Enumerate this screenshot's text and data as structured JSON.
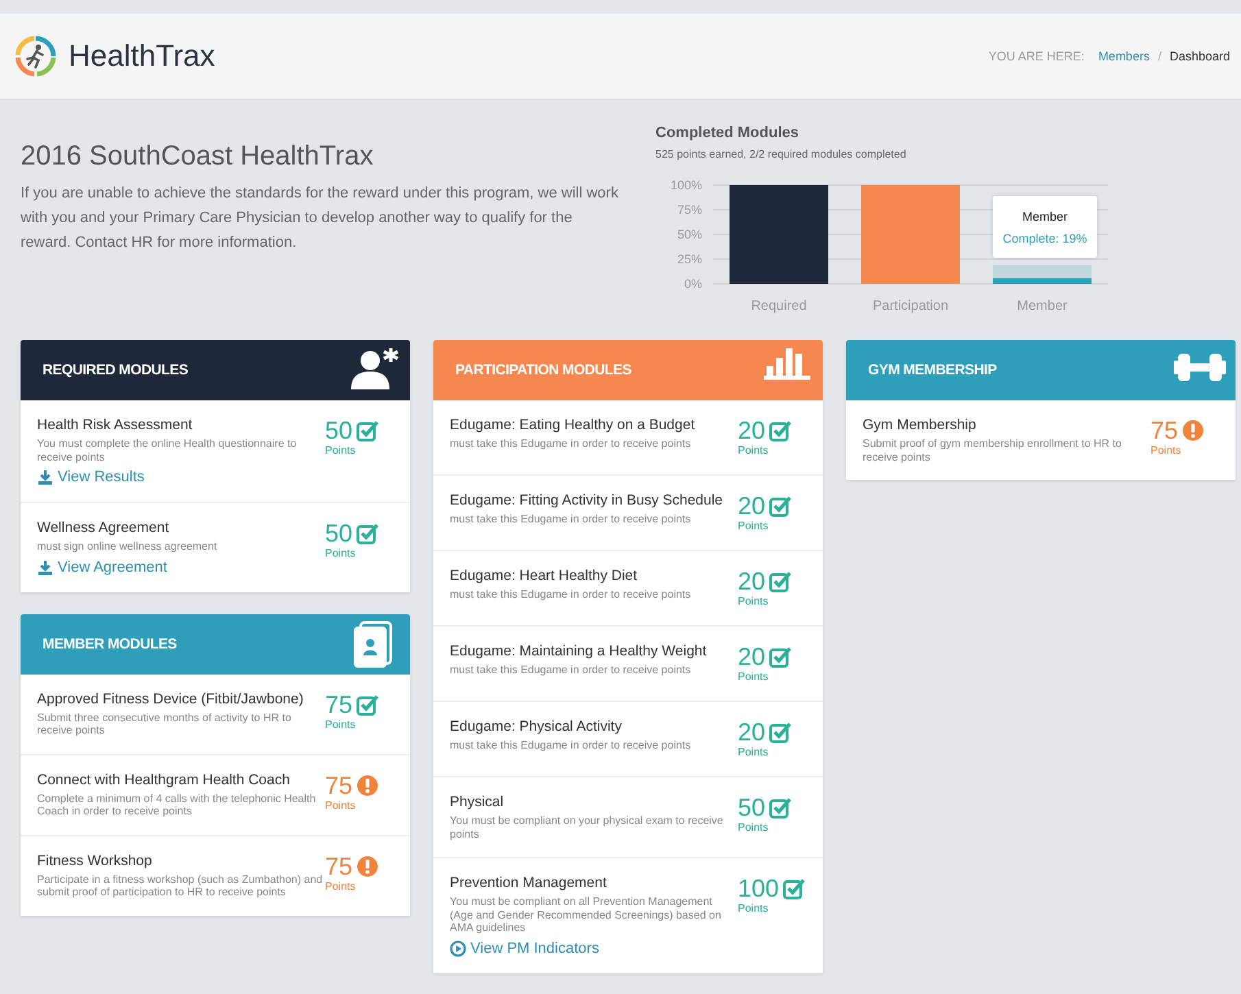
{
  "header": {
    "logo_text": "HealthTrax",
    "breadcrumb": {
      "label": "YOU ARE HERE:",
      "items": [
        {
          "text": "Members",
          "link": true
        },
        {
          "text": "/",
          "kind": "separator"
        },
        {
          "text": "Dashboard",
          "link": false
        }
      ]
    }
  },
  "intro": {
    "title": "2016 SouthCoast HealthTrax",
    "text": "If you are unable to achieve the standards for the reward under this program, we will work with you and your Primary Care Physician to develop another way to qualify for the reward. Contact HR for more information."
  },
  "completed": {
    "title": "Completed Modules",
    "subtitle": "525 points earned, 2/2 required modules completed",
    "chart_data": {
      "type": "bar",
      "grid": true,
      "ylim": [
        0,
        100
      ],
      "yticks": [
        {
          "value": 0,
          "label": "0%"
        },
        {
          "value": 25,
          "label": "25%"
        },
        {
          "value": 50,
          "label": "50%"
        },
        {
          "value": 75,
          "label": "75%"
        },
        {
          "value": 100,
          "label": "100%"
        }
      ],
      "series": [
        {
          "name": "Required",
          "color": "#1e2838",
          "values": [
            100
          ]
        },
        {
          "name": "Participation",
          "color": "#f5874f",
          "values": [
            100
          ]
        },
        {
          "name": "Member",
          "color": "#2e9fba",
          "values": [
            19
          ]
        }
      ]
    },
    "tooltip": {
      "title": "Member",
      "text": "Complete: 19%"
    }
  },
  "columns": [
    [
      {
        "title": "REQUIRED MODULES",
        "color": "#1e2838",
        "kind": "person",
        "items": [
          {
            "title": "Health Risk Assessment",
            "description": "You must complete the online Health questionnaire to receive points",
            "points": "50",
            "unit": "Points",
            "complete": true,
            "link": {
              "text": "View Results",
              "kind": "download"
            }
          },
          {
            "title": "Wellness Agreement",
            "description": "must sign online wellness agreement",
            "points": "50",
            "unit": "Points",
            "complete": true,
            "link": {
              "text": "View Agreement",
              "kind": "download"
            }
          }
        ]
      },
      {
        "title": "MEMBER MODULES",
        "color": "#2e9fba",
        "kind": "card",
        "items": [
          {
            "title": "Approved Fitness Device (Fitbit/Jawbone)",
            "description": "Submit three consecutive months of activity to HR to receive points",
            "points": "75",
            "unit": "Points",
            "complete": true
          },
          {
            "title": "Connect with Healthgram Health Coach",
            "description": "Complete a minimum of 4 calls with the telephonic Health Coach in order to receive points",
            "points": "75",
            "unit": "Points",
            "complete": false
          },
          {
            "title": "Fitness Workshop",
            "description": "Participate in a fitness workshop (such as Zumbathon) and submit proof of participation to HR to receive points",
            "points": "75",
            "unit": "Points",
            "complete": false
          }
        ]
      }
    ],
    [
      {
        "title": "PARTICIPATION MODULES",
        "color": "#f5874f",
        "kind": "bars",
        "items": [
          {
            "title": "Edugame: Eating Healthy on a Budget",
            "description": "must take this Edugame in order to receive points",
            "points": "20",
            "unit": "Points",
            "complete": true
          },
          {
            "title": "Edugame: Fitting Activity in Busy Schedule",
            "description": "must take this Edugame in order to receive points",
            "points": "20",
            "unit": "Points",
            "complete": true
          },
          {
            "title": "Edugame: Heart Healthy Diet",
            "description": "must take this Edugame in order to receive points",
            "points": "20",
            "unit": "Points",
            "complete": true
          },
          {
            "title": "Edugame: Maintaining a Healthy Weight",
            "description": "must take this Edugame in order to receive points",
            "points": "20",
            "unit": "Points",
            "complete": true
          },
          {
            "title": "Edugame: Physical Activity",
            "description": "must take this Edugame in order to receive points",
            "points": "20",
            "unit": "Points",
            "complete": true
          },
          {
            "title": "Physical",
            "description": "You must be compliant on your physical exam to receive points",
            "points": "50",
            "unit": "Points",
            "complete": true
          },
          {
            "title": "Prevention Management",
            "description": "You must be compliant on all Prevention Management (Age and Gender Recommended Screenings) based on AMA guidelines",
            "points": "100",
            "unit": "Points",
            "complete": true,
            "link": {
              "text": "View PM Indicators",
              "kind": "play"
            }
          }
        ]
      }
    ],
    [
      {
        "title": "GYM MEMBERSHIP",
        "color": "#2e9fba",
        "kind": "dumbbell",
        "items": [
          {
            "title": "Gym Membership",
            "description": "Submit proof of gym membership enrollment to HR to receive points",
            "points": "75",
            "unit": "Points",
            "complete": false
          }
        ]
      }
    ]
  ]
}
